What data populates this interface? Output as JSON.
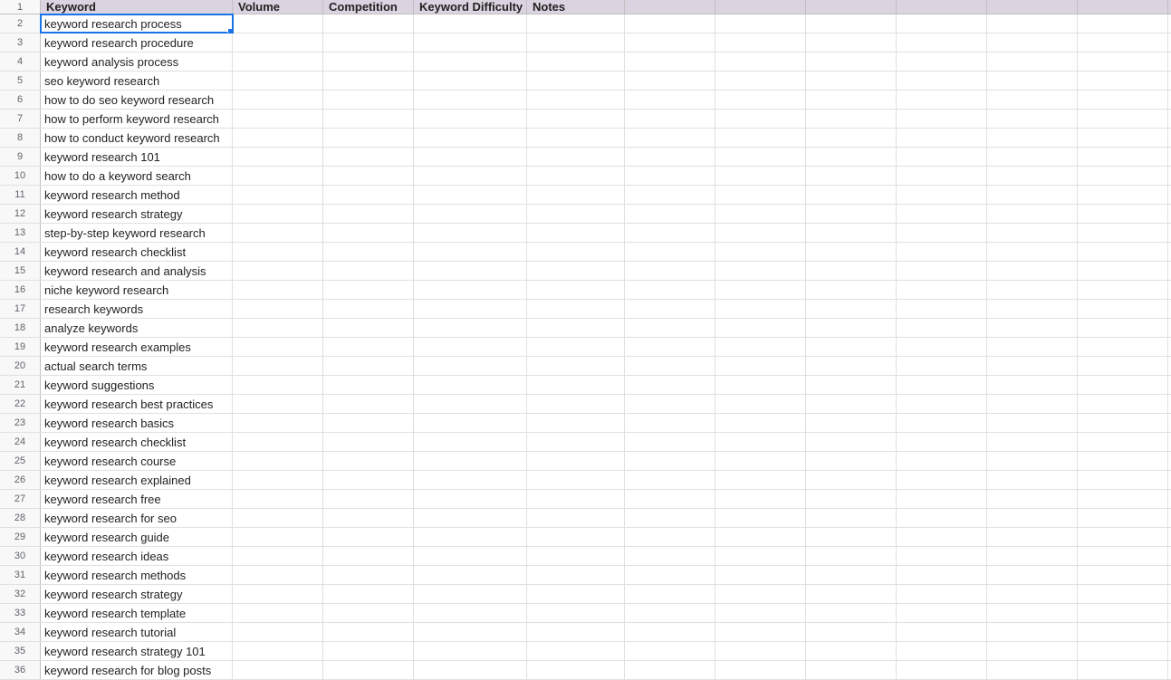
{
  "headers": {
    "rownum": "1",
    "keyword": "Keyword",
    "volume": "Volume",
    "competition": "Competition",
    "kd": "Keyword Difficulty",
    "notes": "Notes"
  },
  "selected_cell": {
    "row": 2,
    "col": "keyword"
  },
  "rows": [
    {
      "n": 2,
      "keyword": "keyword research process"
    },
    {
      "n": 3,
      "keyword": "keyword research procedure"
    },
    {
      "n": 4,
      "keyword": "keyword analysis process"
    },
    {
      "n": 5,
      "keyword": "seo keyword research"
    },
    {
      "n": 6,
      "keyword": "how to do seo keyword research"
    },
    {
      "n": 7,
      "keyword": "how to perform keyword research"
    },
    {
      "n": 8,
      "keyword": "how to conduct keyword research"
    },
    {
      "n": 9,
      "keyword": "keyword research 101"
    },
    {
      "n": 10,
      "keyword": "how to do a keyword search"
    },
    {
      "n": 11,
      "keyword": "keyword research method"
    },
    {
      "n": 12,
      "keyword": "keyword research strategy"
    },
    {
      "n": 13,
      "keyword": "step-by-step keyword research"
    },
    {
      "n": 14,
      "keyword": "keyword research checklist"
    },
    {
      "n": 15,
      "keyword": "keyword research and analysis"
    },
    {
      "n": 16,
      "keyword": "niche keyword research"
    },
    {
      "n": 17,
      "keyword": "research keywords"
    },
    {
      "n": 18,
      "keyword": "analyze keywords"
    },
    {
      "n": 19,
      "keyword": "keyword research examples"
    },
    {
      "n": 20,
      "keyword": "actual search terms"
    },
    {
      "n": 21,
      "keyword": "keyword suggestions"
    },
    {
      "n": 22,
      "keyword": "keyword research best practices"
    },
    {
      "n": 23,
      "keyword": "keyword research basics"
    },
    {
      "n": 24,
      "keyword": "keyword research checklist"
    },
    {
      "n": 25,
      "keyword": "keyword research course"
    },
    {
      "n": 26,
      "keyword": "keyword research explained"
    },
    {
      "n": 27,
      "keyword": "keyword research free"
    },
    {
      "n": 28,
      "keyword": "keyword research for seo"
    },
    {
      "n": 29,
      "keyword": "keyword research guide"
    },
    {
      "n": 30,
      "keyword": "keyword research ideas"
    },
    {
      "n": 31,
      "keyword": "keyword research methods"
    },
    {
      "n": 32,
      "keyword": "keyword research strategy"
    },
    {
      "n": 33,
      "keyword": "keyword research template"
    },
    {
      "n": 34,
      "keyword": "keyword research tutorial"
    },
    {
      "n": 35,
      "keyword": "keyword research strategy 101"
    },
    {
      "n": 36,
      "keyword": "keyword research for blog posts"
    }
  ],
  "extra_cols_count": 6
}
